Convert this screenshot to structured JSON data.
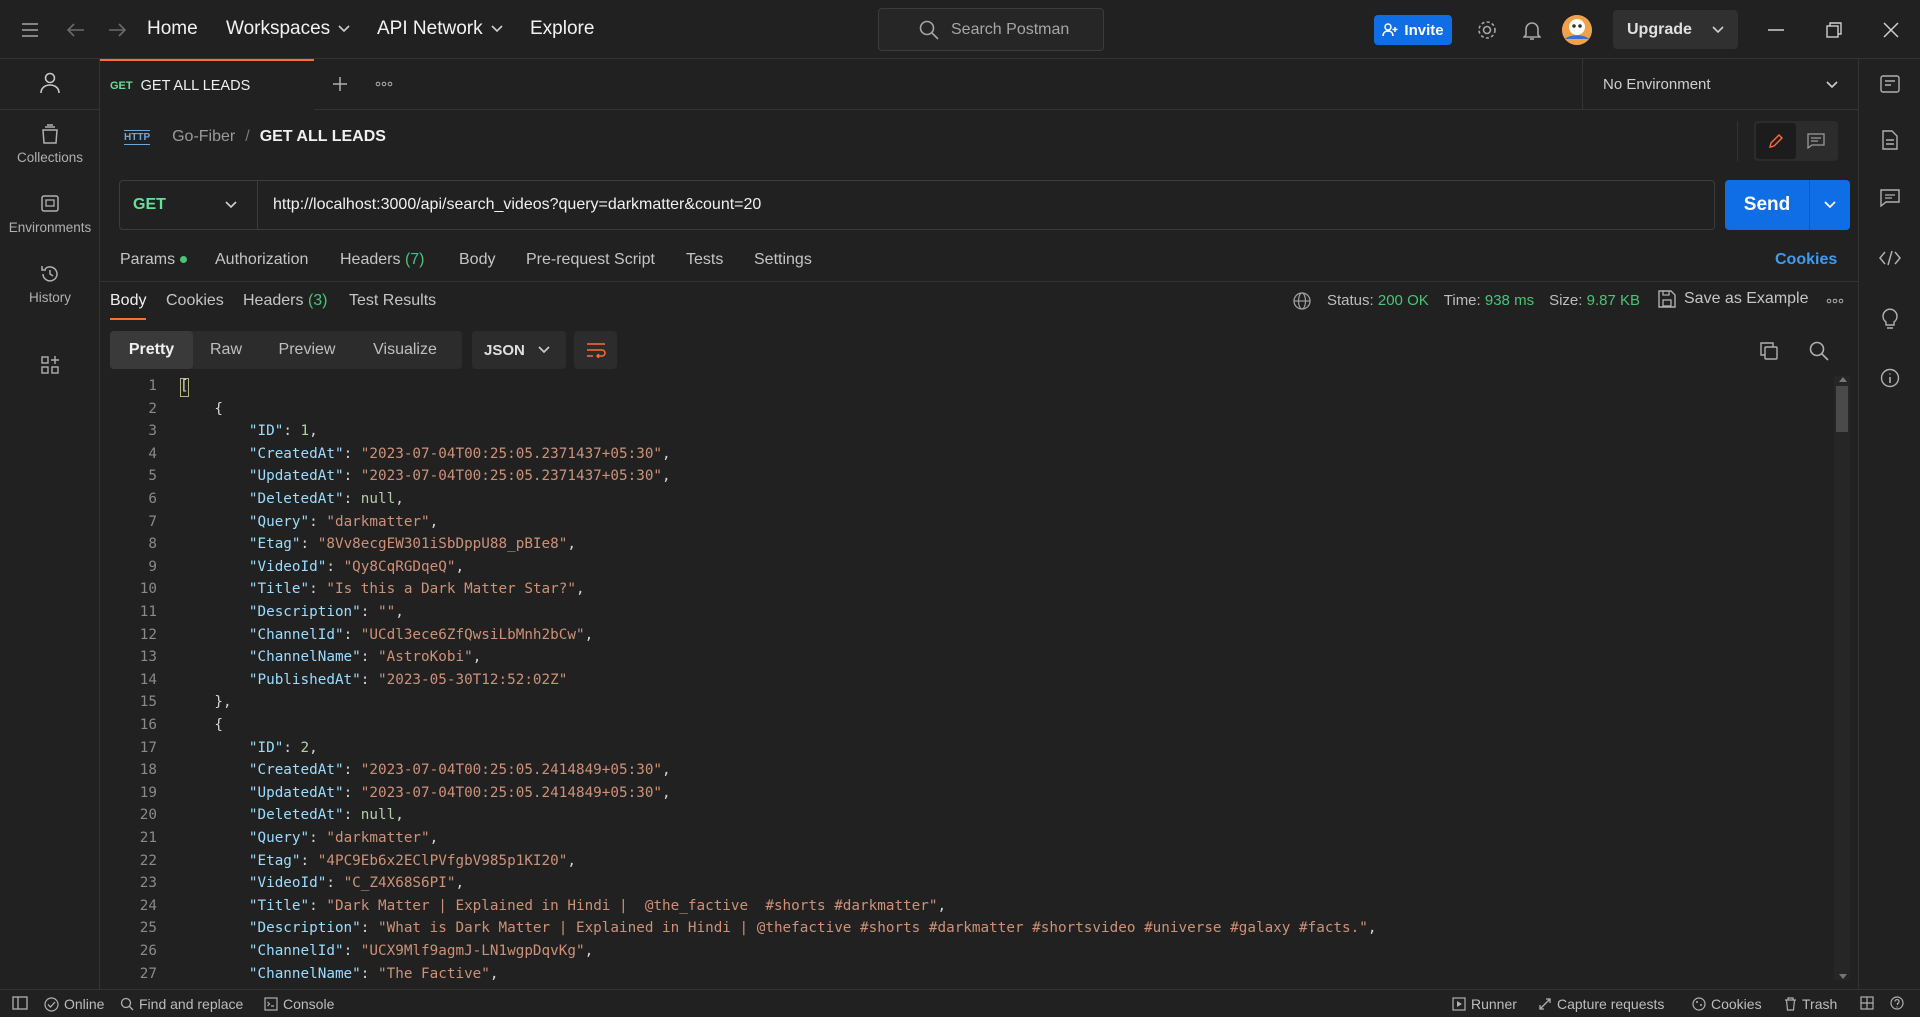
{
  "topbar": {
    "nav": [
      "Home",
      "Workspaces",
      "API Network",
      "Explore"
    ],
    "search_placeholder": "Search Postman",
    "invite": "Invite",
    "upgrade": "Upgrade"
  },
  "sidebar": {
    "items": [
      {
        "label": "Collections",
        "icon": "collections-icon"
      },
      {
        "label": "Environments",
        "icon": "environments-icon"
      },
      {
        "label": "History",
        "icon": "history-icon"
      }
    ]
  },
  "tab": {
    "method": "GET",
    "name": "GET ALL LEADS"
  },
  "environment": "No Environment",
  "breadcrumb": {
    "badge": "HTTP",
    "collection": "Go-Fiber",
    "sep": "/",
    "request": "GET ALL LEADS"
  },
  "request": {
    "method": "GET",
    "url": "http://localhost:3000/api/search_videos?query=darkmatter&count=20",
    "send": "Send"
  },
  "request_tabs": {
    "params": "Params",
    "authorization": "Authorization",
    "headers": "Headers",
    "headers_count": "(7)",
    "body": "Body",
    "prerequest": "Pre-request Script",
    "tests": "Tests",
    "settings": "Settings",
    "cookies": "Cookies"
  },
  "response_tabs": {
    "body": "Body",
    "cookies": "Cookies",
    "headers": "Headers",
    "headers_count": "(3)",
    "test_results": "Test Results"
  },
  "response_meta": {
    "status_label": "Status:",
    "status": "200 OK",
    "time_label": "Time:",
    "time": "938 ms",
    "size_label": "Size:",
    "size": "9.87 KB",
    "save": "Save as Example"
  },
  "view_modes": [
    "Pretty",
    "Raw",
    "Preview",
    "Visualize"
  ],
  "format": "JSON",
  "code_lines": [
    [
      [
        "p",
        "["
      ]
    ],
    [
      [
        "p",
        "    {"
      ]
    ],
    [
      [
        "p",
        "        "
      ],
      [
        "k",
        "\"ID\""
      ],
      [
        "p",
        ": "
      ],
      [
        "n",
        "1"
      ],
      [
        "p",
        ","
      ]
    ],
    [
      [
        "p",
        "        "
      ],
      [
        "k",
        "\"CreatedAt\""
      ],
      [
        "p",
        ": "
      ],
      [
        "s",
        "\"2023-07-04T00:25:05.2371437+05:30\""
      ],
      [
        "p",
        ","
      ]
    ],
    [
      [
        "p",
        "        "
      ],
      [
        "k",
        "\"UpdatedAt\""
      ],
      [
        "p",
        ": "
      ],
      [
        "s",
        "\"2023-07-04T00:25:05.2371437+05:30\""
      ],
      [
        "p",
        ","
      ]
    ],
    [
      [
        "p",
        "        "
      ],
      [
        "k",
        "\"DeletedAt\""
      ],
      [
        "p",
        ": "
      ],
      [
        "n",
        "null"
      ],
      [
        "p",
        ","
      ]
    ],
    [
      [
        "p",
        "        "
      ],
      [
        "k",
        "\"Query\""
      ],
      [
        "p",
        ": "
      ],
      [
        "s",
        "\"darkmatter\""
      ],
      [
        "p",
        ","
      ]
    ],
    [
      [
        "p",
        "        "
      ],
      [
        "k",
        "\"Etag\""
      ],
      [
        "p",
        ": "
      ],
      [
        "s",
        "\"8Vv8ecgEW301iSbDppU88_pBIe8\""
      ],
      [
        "p",
        ","
      ]
    ],
    [
      [
        "p",
        "        "
      ],
      [
        "k",
        "\"VideoId\""
      ],
      [
        "p",
        ": "
      ],
      [
        "s",
        "\"Qy8CqRGDqeQ\""
      ],
      [
        "p",
        ","
      ]
    ],
    [
      [
        "p",
        "        "
      ],
      [
        "k",
        "\"Title\""
      ],
      [
        "p",
        ": "
      ],
      [
        "s",
        "\"Is this a Dark Matter Star?\""
      ],
      [
        "p",
        ","
      ]
    ],
    [
      [
        "p",
        "        "
      ],
      [
        "k",
        "\"Description\""
      ],
      [
        "p",
        ": "
      ],
      [
        "s",
        "\"\""
      ],
      [
        "p",
        ","
      ]
    ],
    [
      [
        "p",
        "        "
      ],
      [
        "k",
        "\"ChannelId\""
      ],
      [
        "p",
        ": "
      ],
      [
        "s",
        "\"UCdl3ece6ZfQwsiLbMnh2bCw\""
      ],
      [
        "p",
        ","
      ]
    ],
    [
      [
        "p",
        "        "
      ],
      [
        "k",
        "\"ChannelName\""
      ],
      [
        "p",
        ": "
      ],
      [
        "s",
        "\"AstroKobi\""
      ],
      [
        "p",
        ","
      ]
    ],
    [
      [
        "p",
        "        "
      ],
      [
        "k",
        "\"PublishedAt\""
      ],
      [
        "p",
        ": "
      ],
      [
        "s",
        "\"2023-05-30T12:52:02Z\""
      ]
    ],
    [
      [
        "p",
        "    },"
      ]
    ],
    [
      [
        "p",
        "    {"
      ]
    ],
    [
      [
        "p",
        "        "
      ],
      [
        "k",
        "\"ID\""
      ],
      [
        "p",
        ": "
      ],
      [
        "n",
        "2"
      ],
      [
        "p",
        ","
      ]
    ],
    [
      [
        "p",
        "        "
      ],
      [
        "k",
        "\"CreatedAt\""
      ],
      [
        "p",
        ": "
      ],
      [
        "s",
        "\"2023-07-04T00:25:05.2414849+05:30\""
      ],
      [
        "p",
        ","
      ]
    ],
    [
      [
        "p",
        "        "
      ],
      [
        "k",
        "\"UpdatedAt\""
      ],
      [
        "p",
        ": "
      ],
      [
        "s",
        "\"2023-07-04T00:25:05.2414849+05:30\""
      ],
      [
        "p",
        ","
      ]
    ],
    [
      [
        "p",
        "        "
      ],
      [
        "k",
        "\"DeletedAt\""
      ],
      [
        "p",
        ": "
      ],
      [
        "n",
        "null"
      ],
      [
        "p",
        ","
      ]
    ],
    [
      [
        "p",
        "        "
      ],
      [
        "k",
        "\"Query\""
      ],
      [
        "p",
        ": "
      ],
      [
        "s",
        "\"darkmatter\""
      ],
      [
        "p",
        ","
      ]
    ],
    [
      [
        "p",
        "        "
      ],
      [
        "k",
        "\"Etag\""
      ],
      [
        "p",
        ": "
      ],
      [
        "s",
        "\"4PC9Eb6x2EClPVfgbV985p1KI20\""
      ],
      [
        "p",
        ","
      ]
    ],
    [
      [
        "p",
        "        "
      ],
      [
        "k",
        "\"VideoId\""
      ],
      [
        "p",
        ": "
      ],
      [
        "s",
        "\"C_Z4X68S6PI\""
      ],
      [
        "p",
        ","
      ]
    ],
    [
      [
        "p",
        "        "
      ],
      [
        "k",
        "\"Title\""
      ],
      [
        "p",
        ": "
      ],
      [
        "s",
        "\"Dark Matter | Explained in Hindi |  @the_factive  #shorts #darkmatter\""
      ],
      [
        "p",
        ","
      ]
    ],
    [
      [
        "p",
        "        "
      ],
      [
        "k",
        "\"Description\""
      ],
      [
        "p",
        ": "
      ],
      [
        "s",
        "\"What is Dark Matter | Explained in Hindi | @thefactive #shorts #darkmatter #shortsvideo #universe #galaxy #facts.\""
      ],
      [
        "p",
        ","
      ]
    ],
    [
      [
        "p",
        "        "
      ],
      [
        "k",
        "\"ChannelId\""
      ],
      [
        "p",
        ": "
      ],
      [
        "s",
        "\"UCX9Mlf9agmJ-LN1wgpDqvKg\""
      ],
      [
        "p",
        ","
      ]
    ],
    [
      [
        "p",
        "        "
      ],
      [
        "k",
        "\"ChannelName\""
      ],
      [
        "p",
        ": "
      ],
      [
        "s",
        "\"The Factive\""
      ],
      [
        "p",
        ","
      ]
    ]
  ],
  "statusbar": {
    "online": "Online",
    "find": "Find and replace",
    "console": "Console",
    "runner": "Runner",
    "capture": "Capture requests",
    "cookies": "Cookies",
    "trash": "Trash"
  }
}
